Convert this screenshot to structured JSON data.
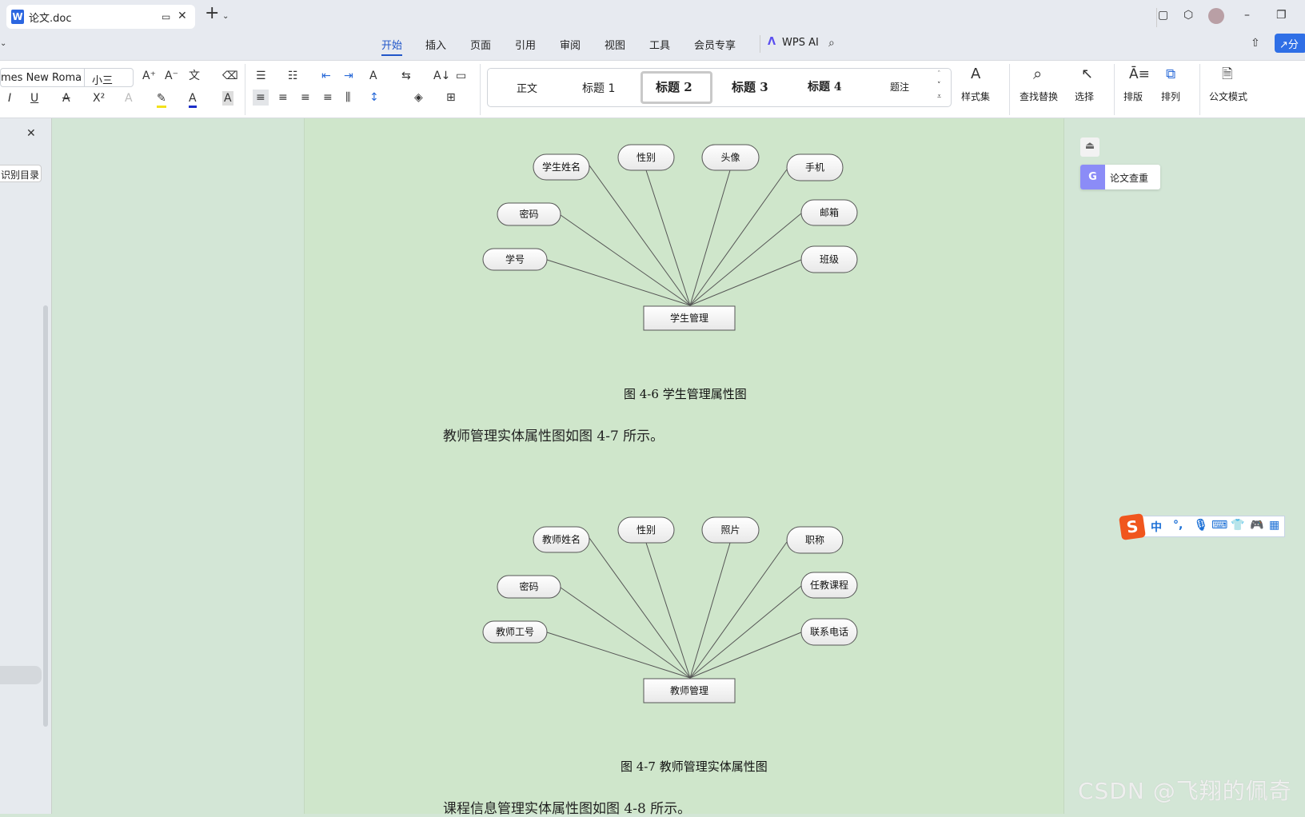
{
  "titlebar": {
    "tab_title": "论文.doc",
    "new_tab": "+"
  },
  "menu": {
    "items": [
      "开始",
      "插入",
      "页面",
      "引用",
      "审阅",
      "视图",
      "工具",
      "会员专享"
    ],
    "active": "开始",
    "wps_ai": "WPS AI",
    "share_label": "分"
  },
  "ribbon": {
    "font_name": "mes New Roma",
    "font_size": "小三",
    "styles": [
      "正文",
      "标题 1",
      "标题 2",
      "标题 3",
      "标题 4",
      "题注"
    ],
    "selected_style": "标题 2",
    "tools": [
      "样式集",
      "查找替换",
      "选择",
      "排版",
      "排列",
      "公文模式"
    ]
  },
  "left_panel": {
    "recognize_toc": "识别目录"
  },
  "right_panel": {
    "paper_check": "论文查重"
  },
  "ime": {
    "mode": "中",
    "punct": "°,"
  },
  "document": {
    "diagram1": {
      "entity": "学生管理",
      "attributes": [
        "学生姓名",
        "性别",
        "头像",
        "手机",
        "密码",
        "邮箱",
        "学号",
        "班级"
      ]
    },
    "caption1": "图 4-6 学生管理属性图",
    "para1": "教师管理实体属性图如图 4-7 所示。",
    "diagram2": {
      "entity": "教师管理",
      "attributes": [
        "教师姓名",
        "性别",
        "照片",
        "职称",
        "密码",
        "任教课程",
        "教师工号",
        "联系电话"
      ]
    },
    "caption2": "图 4-7 教师管理实体属性图",
    "para2": "课程信息管理实体属性图如图 4-8 所示。"
  },
  "watermark": "CSDN @飞翔的佩奇",
  "colors": {
    "accent": "#2156c9",
    "page_bg": "#cfe6cb",
    "paper_check": "#8b8cf7"
  }
}
